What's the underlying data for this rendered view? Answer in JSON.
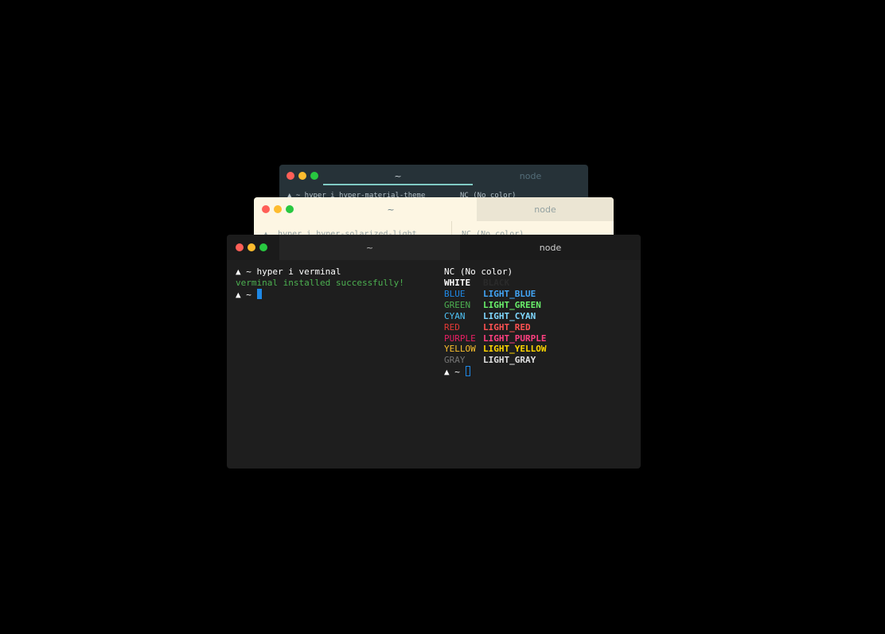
{
  "windows": {
    "material": {
      "tab_left": "~",
      "tab_right": "node",
      "pane_left_line": "▲ ~ hyper i hyper-material-theme",
      "pane_right_line": "NC (No color)"
    },
    "solarized": {
      "tab_left": "~",
      "tab_right": "node",
      "pane_left_line": "▲  hyper i hyper-solarized-light",
      "pane_right_line": "NC (No color)"
    },
    "front": {
      "tab_left": "~",
      "tab_right": "node",
      "left_pane": {
        "command_line": "▲ ~ hyper i verminal",
        "success_line": "verminal installed successfully!",
        "prompt": "▲ ~ "
      },
      "right_pane": {
        "header": "NC (No color)",
        "color_rows": [
          {
            "name": "WHITE",
            "name_color": "#ffffff",
            "light": "BLACK",
            "light_color": "#2a2a2a"
          },
          {
            "name": "BLUE",
            "name_color": "#1e88e5",
            "light": "LIGHT_BLUE",
            "light_color": "#42a5f5"
          },
          {
            "name": "GREEN",
            "name_color": "#4caf50",
            "light": "LIGHT_GREEN",
            "light_color": "#69f06a"
          },
          {
            "name": "CYAN",
            "name_color": "#4fc3f7",
            "light": "LIGHT_CYAN",
            "light_color": "#80d8ff"
          },
          {
            "name": "RED",
            "name_color": "#e53935",
            "light": "LIGHT_RED",
            "light_color": "#ff5252"
          },
          {
            "name": "PURPLE",
            "name_color": "#e91e63",
            "light": "LIGHT_PURPLE",
            "light_color": "#ff4081"
          },
          {
            "name": "YELLOW",
            "name_color": "#fbc02d",
            "light": "LIGHT_YELLOW",
            "light_color": "#ffd600"
          },
          {
            "name": "GRAY",
            "name_color": "#757575",
            "light": "LIGHT_GRAY",
            "light_color": "#e0e0e0"
          }
        ],
        "prompt": "▲ ~ "
      }
    }
  },
  "colors": {
    "prompt_text": "#ffffff",
    "success_text": "#4caf50",
    "cursor": "#1e88e5"
  }
}
